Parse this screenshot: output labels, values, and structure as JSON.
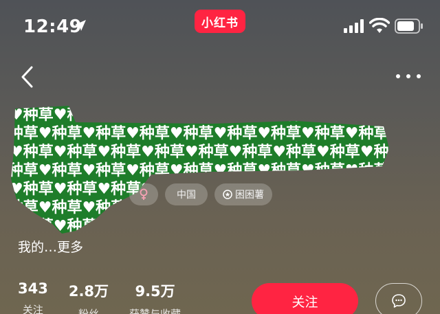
{
  "status_bar": {
    "time": "12:49",
    "brand": "小红书"
  },
  "profile": {
    "sticker_pattern_text": "♥种草",
    "tags": {
      "gender_icon": "female-icon",
      "ip_location": "中国",
      "level": "困困薯"
    },
    "bio": {
      "text": "我的…",
      "more_label": "更多"
    },
    "stats": [
      {
        "value": "343",
        "label": "关注"
      },
      {
        "value": "2.8万",
        "label": "粉丝"
      },
      {
        "value": "9.5万",
        "label": "获赞与收藏"
      }
    ]
  },
  "actions": {
    "follow_label": "关注",
    "message_icon": "chat-bubble-icon"
  },
  "colors": {
    "accent": "#ff2442",
    "sticker_green": "#1e7d2a"
  }
}
